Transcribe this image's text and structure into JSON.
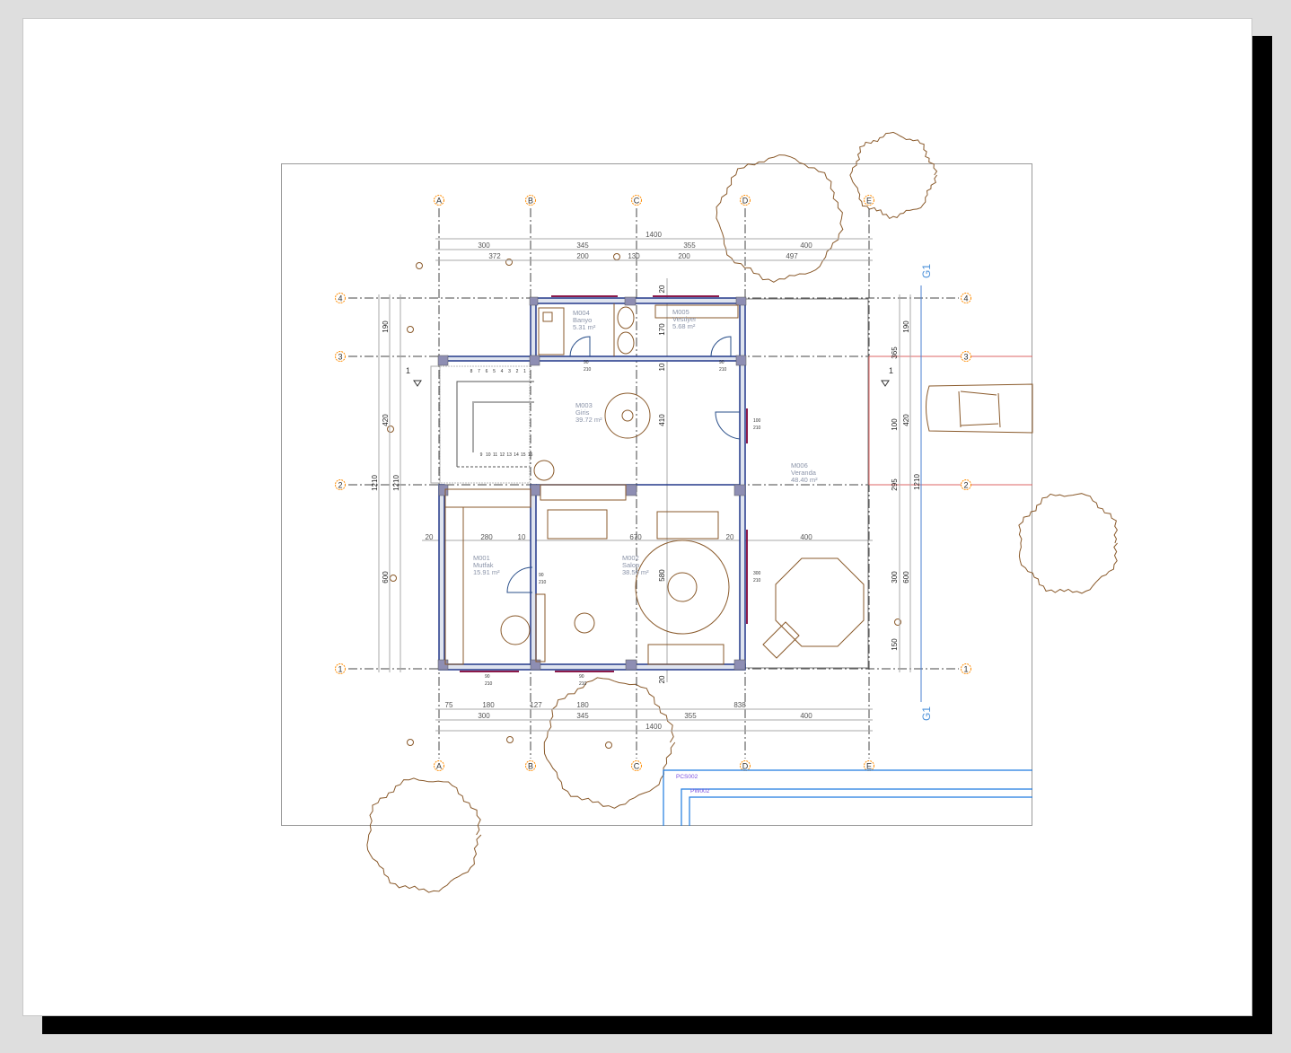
{
  "sheet": {
    "grid_columns": [
      "A",
      "B",
      "C",
      "D",
      "E"
    ],
    "grid_rows": [
      "4",
      "3",
      "2",
      "1"
    ],
    "top_dims": {
      "overall": "1400",
      "bays": [
        "300",
        "345",
        "355",
        "400"
      ],
      "detail": [
        "372",
        "200",
        "130",
        "200",
        "497"
      ]
    },
    "bottom_dims": {
      "overall": "1400",
      "bays": [
        "300",
        "345",
        "355",
        "400"
      ],
      "detail": [
        "75",
        "180",
        "127",
        "180",
        "838"
      ]
    },
    "left_dims": {
      "segments": [
        "190",
        "420",
        "600"
      ],
      "overall_a": "1210",
      "overall_b": "1210"
    },
    "right_dims": {
      "detail": [
        "365",
        "100",
        "295",
        "300",
        "150"
      ],
      "segments": [
        "190",
        "420",
        "600"
      ],
      "overall": "1210"
    },
    "interior_dims": {
      "vertical": [
        "20",
        "170",
        "10",
        "410",
        "580",
        "20"
      ],
      "horizontal": [
        "20",
        "280",
        "10",
        "670",
        "20",
        "400"
      ]
    },
    "rooms": [
      {
        "code": "M001",
        "name": "Mutfak",
        "area": "15.91 m²"
      },
      {
        "code": "M002",
        "name": "Salon",
        "area": "38.50 m²"
      },
      {
        "code": "M003",
        "name": "Giris",
        "area": "39.72 m²"
      },
      {
        "code": "M004",
        "name": "Banyo",
        "area": "5.31 m²"
      },
      {
        "code": "M005",
        "name": "Vestiyer",
        "area": "5.68 m²"
      },
      {
        "code": "M006",
        "name": "Veranda",
        "area": "48.40 m²"
      }
    ],
    "door_tags": [
      {
        "w": "90",
        "h": "210"
      },
      {
        "w": "90",
        "h": "210"
      },
      {
        "w": "100",
        "h": "210"
      },
      {
        "w": "90",
        "h": "210"
      },
      {
        "w": "300",
        "h": "210"
      },
      {
        "w": "90",
        "h": "210"
      },
      {
        "w": "90",
        "h": "210"
      }
    ],
    "section_marker": "1",
    "elevation_marker": "G1",
    "stair_numbers_top": [
      "8",
      "7",
      "6",
      "5",
      "4",
      "3",
      "2",
      "1"
    ],
    "stair_numbers_bottom": [
      "9",
      "10",
      "11",
      "12",
      "13",
      "14",
      "15",
      "16"
    ],
    "title_blocks": [
      "PCS002",
      "PW002"
    ],
    "colors": {
      "grid_bubble": "#ff8c00",
      "wall": "#23388a",
      "furniture": "#8a5a2b",
      "window": "#8b1a4a",
      "elevation": "#4a90d9",
      "title_frame": "#1e7be0"
    }
  }
}
